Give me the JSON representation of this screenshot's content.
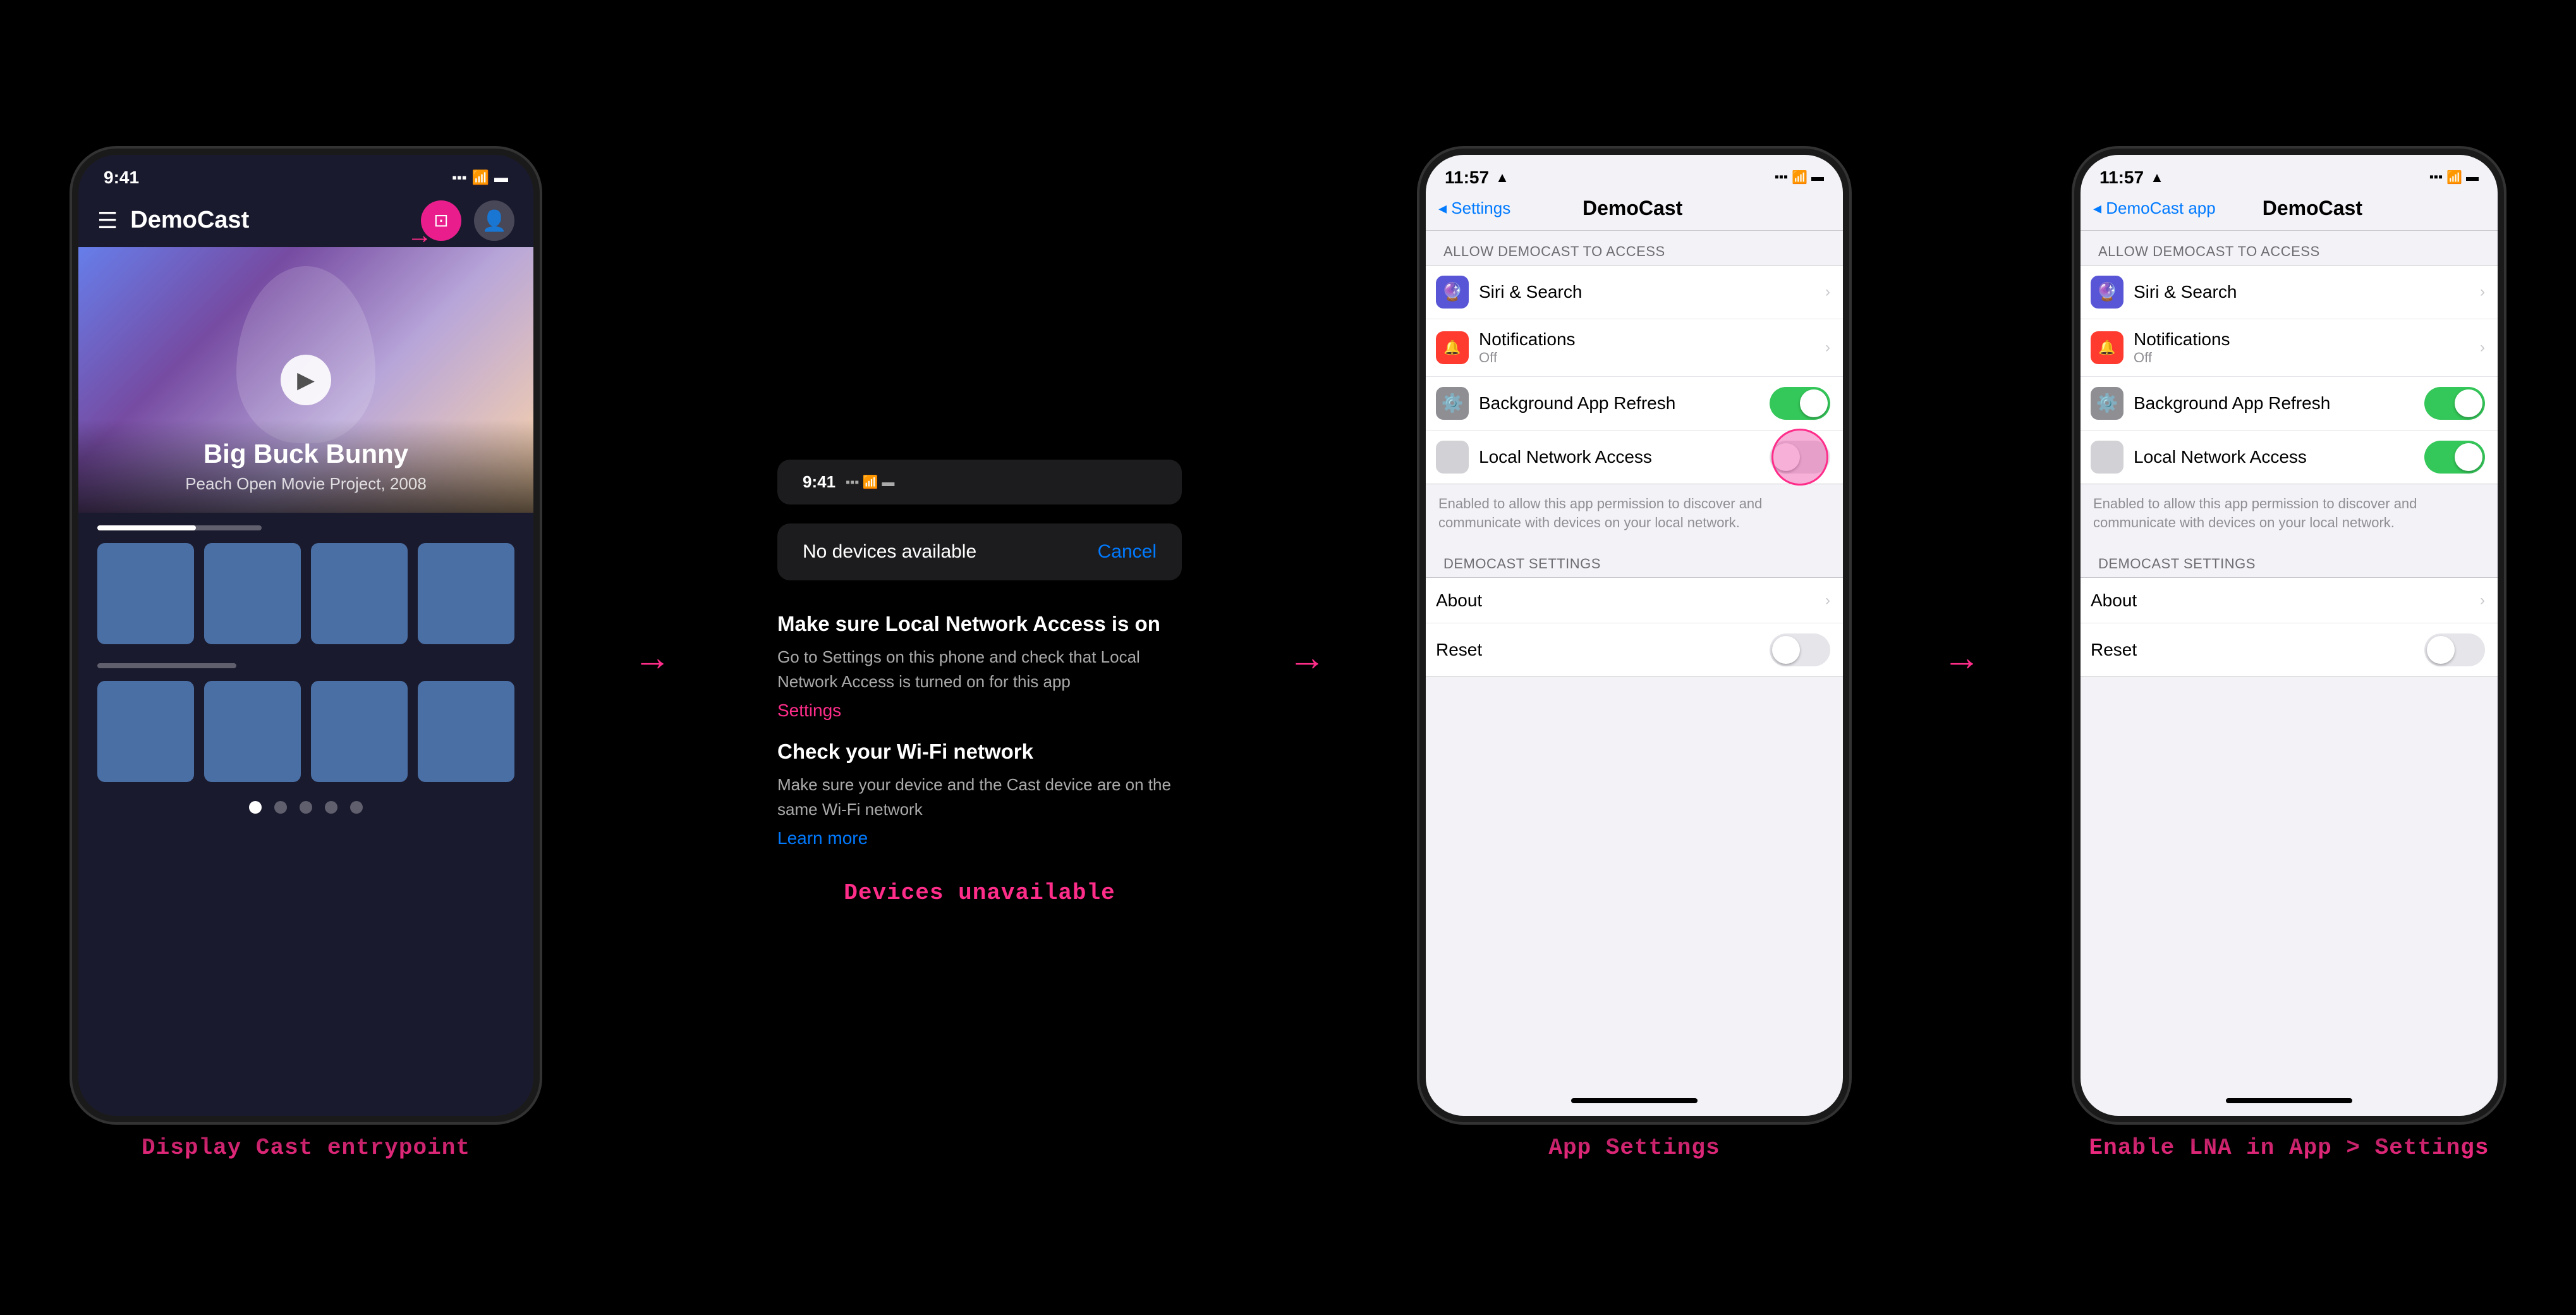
{
  "section1": {
    "label": "Display Cast entrypoint",
    "status_time": "9:41",
    "app_title": "DemoCast",
    "hero_title": "Big Buck Bunny",
    "hero_subtitle": "Peach Open Movie Project, 2008"
  },
  "section2": {
    "label": "Devices unavailable",
    "status_time": "9:41",
    "toast_text": "No devices available",
    "toast_cancel": "Cancel",
    "lna_title": "Make sure Local Network Access is on",
    "lna_desc": "Go to Settings on this phone and check that Local Network Access is turned on for this app",
    "lna_link": "Settings",
    "wifi_title": "Check your Wi-Fi network",
    "wifi_desc": "Make sure your device and the Cast device are on the same Wi-Fi network",
    "wifi_link": "Learn more"
  },
  "section3": {
    "label": "App Settings",
    "status_time": "11:57",
    "back_label": "◂ Settings",
    "nav_title": "DemoCast",
    "section_header": "ALLOW DEMOCAST TO ACCESS",
    "rows": [
      {
        "icon": "🔮",
        "icon_class": "icon-purple",
        "title": "Siri & Search",
        "has_chevron": true
      },
      {
        "icon": "🔴",
        "icon_class": "icon-red",
        "title": "Notifications",
        "subtitle": "Off",
        "has_chevron": true
      },
      {
        "icon": "⚙️",
        "icon_class": "icon-gray",
        "title": "Background App Refresh",
        "toggle": "on"
      },
      {
        "icon": "",
        "icon_class": "icon-light-gray",
        "title": "Local Network Access",
        "toggle": "off_highlight"
      }
    ],
    "lna_note": "Enabled to allow this app permission to discover and communicate with devices on your local network.",
    "section2_header": "DEMOCAST SETTINGS",
    "rows2": [
      {
        "title": "About",
        "has_chevron": true
      },
      {
        "title": "Reset",
        "toggle": "off"
      }
    ]
  },
  "section4": {
    "label": "Enable LNA in App > Settings",
    "status_time": "11:57",
    "back_label": "◂ DemoCast app",
    "nav_title": "DemoCast",
    "section_header": "ALLOW DEMOCAST TO ACCESS",
    "rows": [
      {
        "icon": "🔮",
        "icon_class": "icon-purple",
        "title": "Siri & Search",
        "has_chevron": true
      },
      {
        "icon": "🔴",
        "icon_class": "icon-red",
        "title": "Notifications",
        "subtitle": "Off",
        "has_chevron": true
      },
      {
        "icon": "⚙️",
        "icon_class": "icon-gray",
        "title": "Background App Refresh",
        "toggle": "on"
      },
      {
        "icon": "",
        "icon_class": "icon-light-gray",
        "title": "Local Network Access",
        "toggle": "on"
      }
    ],
    "lna_note": "Enabled to allow this app permission to discover and communicate with devices on your local network.",
    "section2_header": "DEMOCAST SETTINGS",
    "rows2": [
      {
        "title": "About",
        "has_chevron": true
      },
      {
        "title": "Reset",
        "toggle": "off"
      }
    ]
  }
}
